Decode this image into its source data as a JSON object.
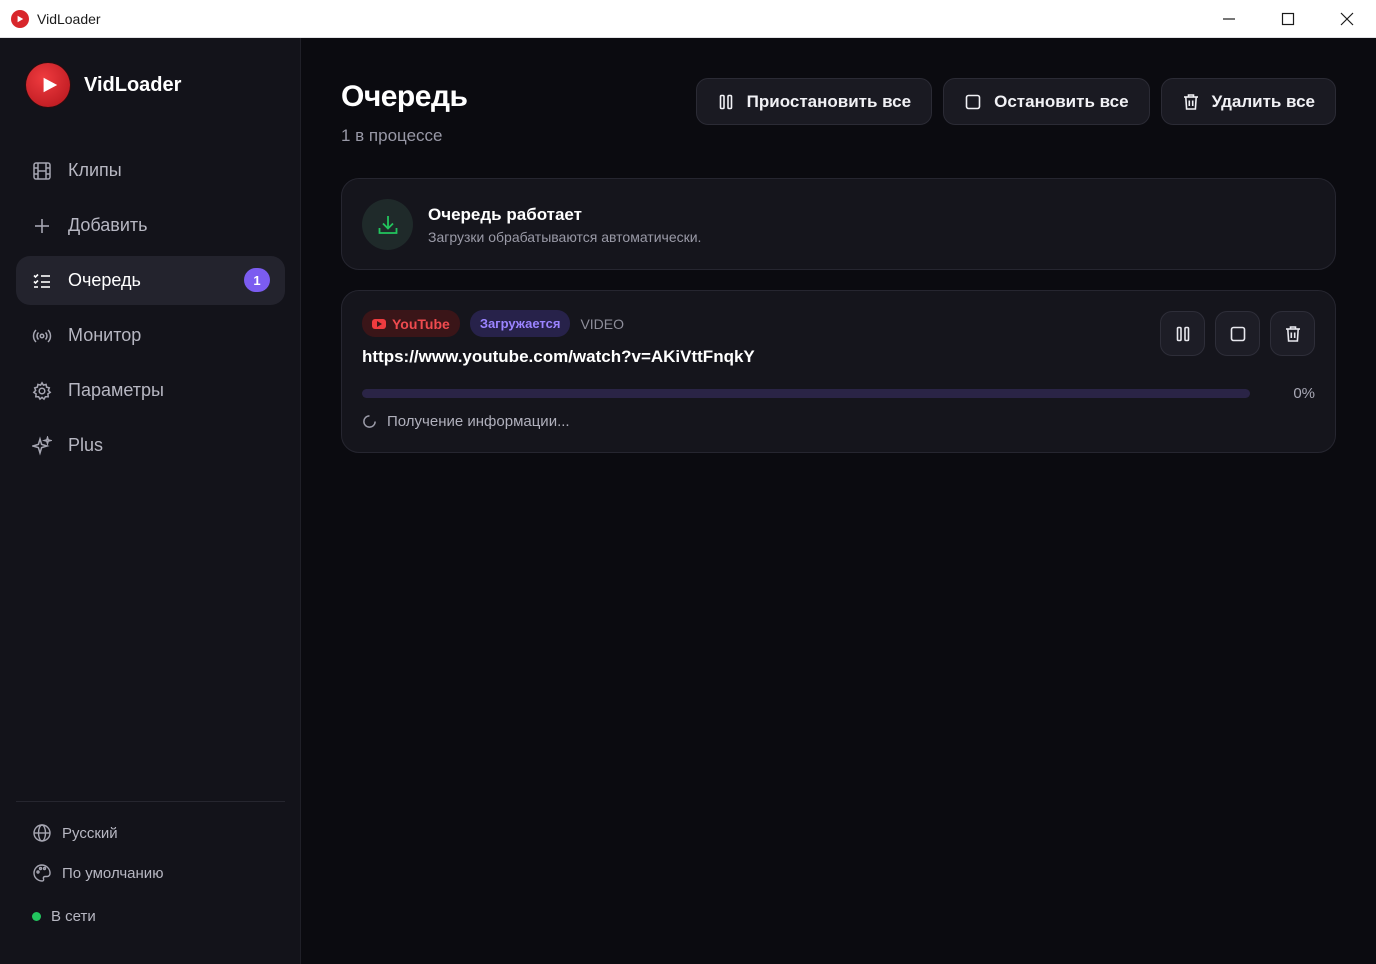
{
  "window": {
    "title": "VidLoader",
    "controls": [
      "minimize",
      "maximize",
      "close"
    ]
  },
  "sidebar": {
    "brand": "VidLoader",
    "items": [
      {
        "label": "Клипы",
        "icon": "film-icon"
      },
      {
        "label": "Добавить",
        "icon": "plus-icon"
      },
      {
        "label": "Очередь",
        "icon": "list-checks-icon",
        "active": true,
        "badge": "1"
      },
      {
        "label": "Монитор",
        "icon": "radio-broadcast-icon"
      },
      {
        "label": "Параметры",
        "icon": "gear-icon"
      },
      {
        "label": "Plus",
        "icon": "sparkles-icon"
      }
    ],
    "footer": {
      "language": "Русский",
      "theme": "По умолчанию",
      "status": "В сети",
      "status_color": "#22c55e"
    }
  },
  "main": {
    "title": "Очередь",
    "subtitle": "1 в процессе",
    "actions": {
      "pause_all": "Приостановить все",
      "stop_all": "Остановить все",
      "delete_all": "Удалить все"
    },
    "info": {
      "title": "Очередь работает",
      "subtitle": "Загрузки обрабатываются автоматически."
    },
    "job": {
      "source": "YouTube",
      "state": "Загружается",
      "type": "VIDEO",
      "url": "https://www.youtube.com/watch?v=AKiVttFnqkY",
      "progress_label": "0%",
      "progress": 0,
      "status_text": "Получение информации..."
    }
  },
  "colors": {
    "accent": "#7b5cf0",
    "brand_red": "#ef3b3f",
    "success": "#22c55e"
  }
}
